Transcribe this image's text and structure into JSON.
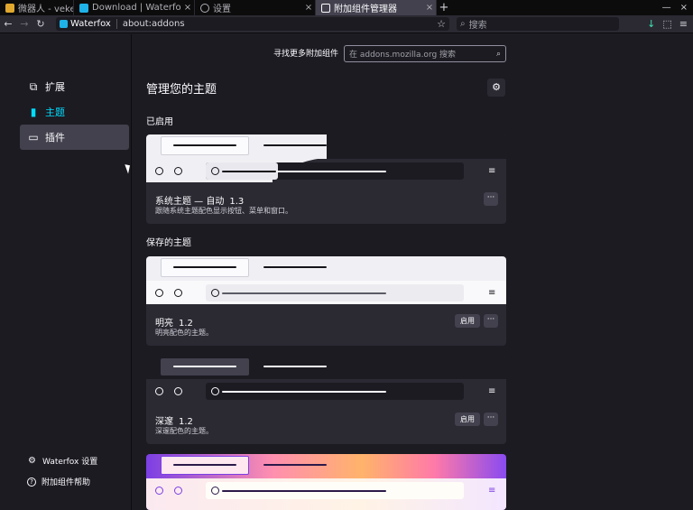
{
  "tabs": [
    {
      "title": "微器人 - veket!",
      "active": false
    },
    {
      "title": "Download | Waterfox",
      "active": false
    },
    {
      "title": "设置",
      "active": false
    },
    {
      "title": "附加组件管理器",
      "active": true
    }
  ],
  "tab_close": "×",
  "new_tab": "+",
  "window_controls": {
    "minimize": "—",
    "close": "×"
  },
  "nav": {
    "back": "←",
    "forward": "→",
    "reload": "↻"
  },
  "urlbar": {
    "identity": "Waterfox",
    "address": "about:addons",
    "bookmark": "☆"
  },
  "searchbar": {
    "placeholder": "搜索"
  },
  "toolbar_right": {
    "downloads": "↓",
    "extensions": "⬚",
    "menu": "≡"
  },
  "sidebar": {
    "categories": [
      {
        "label": "扩展",
        "icon": "puzzle-icon",
        "glyph": "⧉"
      },
      {
        "label": "主题",
        "icon": "brush-icon",
        "glyph": "▮"
      },
      {
        "label": "插件",
        "icon": "plugin-icon",
        "glyph": "▭"
      }
    ],
    "footer": [
      {
        "label": "Waterfox 设置",
        "icon": "gear-icon",
        "glyph": "⚙"
      },
      {
        "label": "附加组件帮助",
        "icon": "help-icon",
        "glyph": "?"
      }
    ]
  },
  "main": {
    "find_more": "寻找更多附加组件",
    "search_placeholder": "在 addons.mozilla.org 搜索",
    "search_icon": "⌕",
    "title": "管理您的主题",
    "settings_glyph": "⚙",
    "enabled_heading": "已启用",
    "saved_heading": "保存的主题",
    "more_glyph": "···",
    "menu_glyph": "≡",
    "themes": [
      {
        "name": "系统主题 — 自动",
        "version": "1.3",
        "description": "跟随系统主题配色显示按钮、菜单和窗口。",
        "enable_label": ""
      },
      {
        "name": "明亮",
        "version": "1.2",
        "description": "明亮配色的主题。",
        "enable_label": "启用"
      },
      {
        "name": "深邃",
        "version": "1.2",
        "description": "深邃配色的主题。",
        "enable_label": "启用"
      }
    ]
  },
  "colors": {
    "accent": "#00ddff",
    "background": "#1c1b22",
    "card": "#2b2a33",
    "button": "#42414d"
  }
}
